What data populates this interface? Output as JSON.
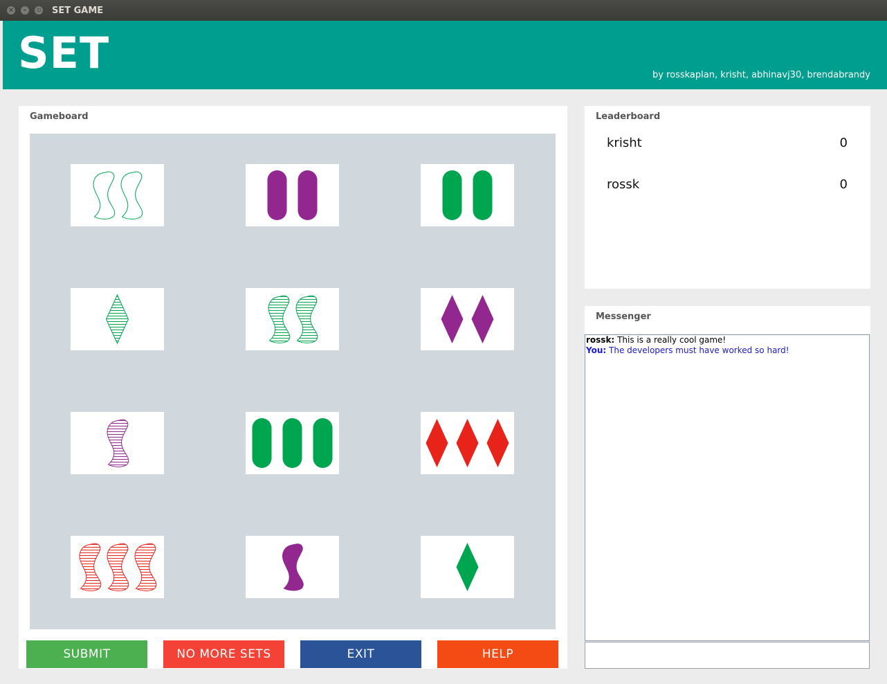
{
  "window": {
    "title": "SET GAME"
  },
  "header": {
    "logo": "SET",
    "credits": "by rosskaplan, krisht, abhinavj30, brendabrandy"
  },
  "gameboard": {
    "title": "Gameboard",
    "cards": [
      {
        "count": 2,
        "shape": "squiggle",
        "color": "#00a550",
        "fill": "empty"
      },
      {
        "count": 2,
        "shape": "oval",
        "color": "#92278f",
        "fill": "solid"
      },
      {
        "count": 2,
        "shape": "oval",
        "color": "#00a550",
        "fill": "solid"
      },
      {
        "count": 1,
        "shape": "diamond",
        "color": "#00a550",
        "fill": "striped"
      },
      {
        "count": 2,
        "shape": "squiggle",
        "color": "#00a550",
        "fill": "striped"
      },
      {
        "count": 2,
        "shape": "diamond",
        "color": "#92278f",
        "fill": "solid"
      },
      {
        "count": 1,
        "shape": "squiggle",
        "color": "#92278f",
        "fill": "striped"
      },
      {
        "count": 3,
        "shape": "oval",
        "color": "#00a550",
        "fill": "solid"
      },
      {
        "count": 3,
        "shape": "diamond",
        "color": "#e8241a",
        "fill": "solid"
      },
      {
        "count": 3,
        "shape": "squiggle",
        "color": "#e8241a",
        "fill": "striped"
      },
      {
        "count": 1,
        "shape": "squiggle",
        "color": "#92278f",
        "fill": "solid"
      },
      {
        "count": 1,
        "shape": "diamond",
        "color": "#00a550",
        "fill": "solid"
      }
    ]
  },
  "buttons": {
    "submit": {
      "label": "SUBMIT",
      "color": "#4caf50"
    },
    "no_more_sets": {
      "label": "NO MORE SETS",
      "color": "#f44336"
    },
    "exit": {
      "label": "EXIT",
      "color": "#2b5398"
    },
    "help": {
      "label": "HELP",
      "color": "#f44a14"
    }
  },
  "leaderboard": {
    "title": "Leaderboard",
    "players": [
      {
        "name": "krisht",
        "score": "0"
      },
      {
        "name": "rossk",
        "score": "0"
      }
    ]
  },
  "messenger": {
    "title": "Messenger",
    "messages": [
      {
        "sender": "rossk:",
        "text": "This is a really cool game!",
        "color": "#000000"
      },
      {
        "sender": "You:",
        "text": "The developers must have worked so hard!",
        "color": "#1a1acd"
      }
    ],
    "input_value": ""
  }
}
